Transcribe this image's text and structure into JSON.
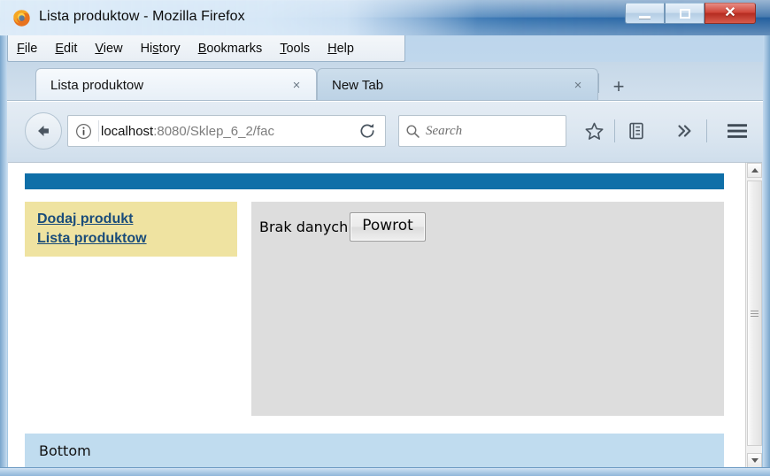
{
  "window": {
    "title": "Lista produktow - Mozilla Firefox",
    "logo_icon": "firefox-logo-icon",
    "controls": {
      "minimize_label": "Minimize",
      "minimize_icon": "minimize-icon",
      "maximize_label": "Maximize",
      "maximize_icon": "maximize-icon",
      "close_label": "Close",
      "close_glyph": "✕"
    }
  },
  "menubar": {
    "items": [
      {
        "label": "File",
        "accel": "F"
      },
      {
        "label": "Edit",
        "accel": "E"
      },
      {
        "label": "View",
        "accel": "V"
      },
      {
        "label": "History",
        "accel": "s"
      },
      {
        "label": "Bookmarks",
        "accel": "B"
      },
      {
        "label": "Tools",
        "accel": "T"
      },
      {
        "label": "Help",
        "accel": "H"
      }
    ]
  },
  "tabs": {
    "items": [
      {
        "label": "Lista produktow",
        "close_glyph": "×",
        "active": true
      },
      {
        "label": "New Tab",
        "close_glyph": "×",
        "active": false
      }
    ],
    "newtab_glyph": "+",
    "newtab_name": "new-tab-button"
  },
  "toolbar": {
    "back_icon": "back-arrow-icon",
    "identity_icon": "info-circle-icon",
    "url_host": "localhost",
    "url_path": ":8080/Sklep_6_2/fac",
    "url_full": "localhost:8080/Sklep_6_2/fac",
    "reload_icon": "reload-icon",
    "search_icon": "search-icon",
    "search_placeholder": "Search",
    "search_value": "",
    "bookmark_icon": "star-icon",
    "library_icon": "library-icon",
    "overflow_icon": "chevron-double-right-icon",
    "menu_icon": "hamburger-menu-icon"
  },
  "page": {
    "banner": {
      "name": "page-banner",
      "color": "#0f6fa8"
    },
    "sidebar": {
      "background": "#efe3a1",
      "link_color": "#1a4c7a",
      "links": [
        {
          "label": "Dodaj produkt"
        },
        {
          "label": "Lista produktow"
        }
      ]
    },
    "main": {
      "background": "#dddddd",
      "message": "Brak danych",
      "button_label": "Powrot"
    },
    "footer": {
      "background": "#c0dcef",
      "label": "Bottom"
    }
  },
  "scrollbar": {
    "up_label": "Scroll up",
    "down_label": "Scroll down",
    "thumb_label": "Scroll thumb"
  }
}
